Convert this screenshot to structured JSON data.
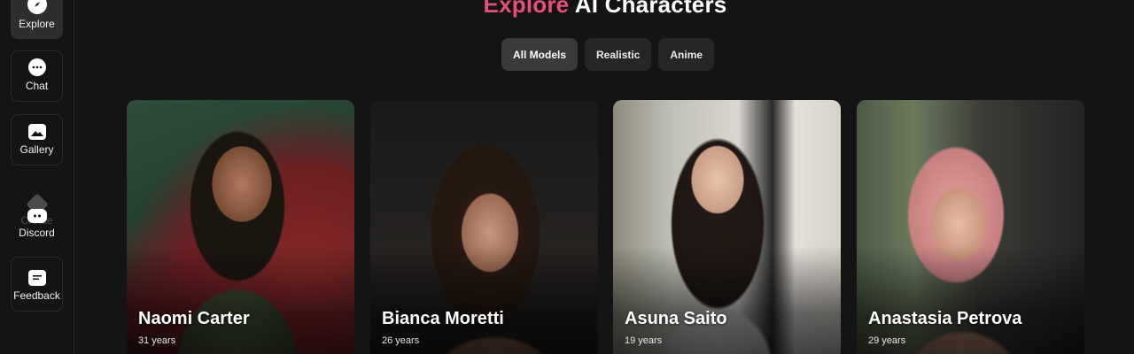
{
  "sidebar": {
    "items": [
      {
        "label": "Explore",
        "icon": "compass-icon"
      },
      {
        "label": "Chat",
        "icon": "chat-bubble-icon"
      },
      {
        "label": "Gallery",
        "icon": "image-icon"
      },
      {
        "label": "Discord",
        "icon": "discord-icon"
      },
      {
        "label": "Feedback",
        "icon": "feedback-icon"
      }
    ],
    "ghost_label": "Create"
  },
  "header": {
    "title_accent": "Explore",
    "title_rest": " AI Characters",
    "accent_color": "#e5507a"
  },
  "filters": {
    "tabs": [
      "All Models",
      "Realistic",
      "Anime"
    ],
    "selected": "All Models"
  },
  "characters": [
    {
      "name": "Naomi Carter",
      "age": "31 years"
    },
    {
      "name": "Bianca Moretti",
      "age": "26 years"
    },
    {
      "name": "Asuna Saito",
      "age": "19 years"
    },
    {
      "name": "Anastasia Petrova",
      "age": "29 years"
    }
  ]
}
